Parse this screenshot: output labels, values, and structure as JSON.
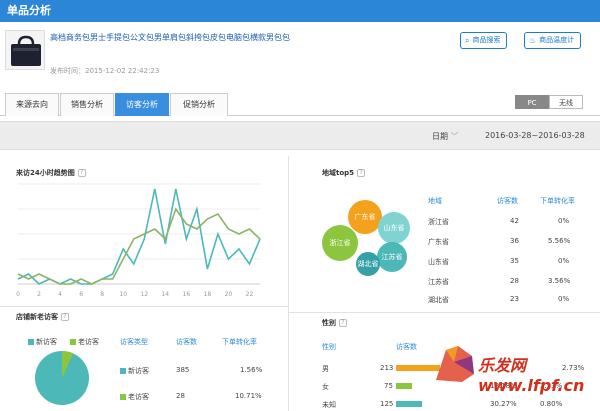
{
  "header": {
    "title": "单品分析"
  },
  "product": {
    "title": "高档商务包男士手提包公文包男单肩包斜挎包皮包电脑包横款男包包",
    "time": "发布时间：2015-12-02 22:42:23",
    "search_btn": "商品搜索",
    "temp_btn": "商品温度计"
  },
  "tabs": [
    "来源去向",
    "销售分析",
    "访客分析",
    "促销分析"
  ],
  "device": {
    "pc": "PC",
    "wireless": "无线"
  },
  "datebar": {
    "label": "日期",
    "range": "2016-03-28~2016-03-28"
  },
  "trend": {
    "title": "来访24小时趋势图",
    "x_ticks": [
      "0",
      "2",
      "4",
      "6",
      "8",
      "10",
      "12",
      "14",
      "16",
      "18",
      "20",
      "22"
    ]
  },
  "region": {
    "title": "地域top5",
    "headers": [
      "地域",
      "访客数",
      "下单转化率"
    ],
    "rows": [
      [
        "浙江省",
        "42",
        "0%"
      ],
      [
        "广东省",
        "36",
        "5.56%"
      ],
      [
        "山东省",
        "35",
        "0%"
      ],
      [
        "江苏省",
        "28",
        "3.56%"
      ],
      [
        "湖北省",
        "23",
        "0%"
      ]
    ],
    "bubbles": [
      "广东省",
      "山东省",
      "浙江省",
      "江苏省",
      "湖北省"
    ]
  },
  "newold": {
    "title": "店铺新老访客",
    "legend": [
      "新访客",
      "老访客"
    ],
    "headers": [
      "访客类型",
      "访客数",
      "下单转化率"
    ],
    "rows": [
      [
        "新访客",
        "385",
        "1.56%"
      ],
      [
        "老访客",
        "28",
        "10.71%"
      ]
    ]
  },
  "gender": {
    "title": "性别",
    "headers": [
      "性别",
      "访客数"
    ],
    "rows": [
      [
        "男",
        "213",
        "",
        "2.73%"
      ],
      [
        "女",
        "75",
        "18.18%",
        "2.33%"
      ],
      [
        "未知",
        "125",
        "30.27%",
        "0.80%"
      ]
    ]
  },
  "watermark": "乐发网 www.lfpf.cn",
  "chart_data": {
    "type": "line",
    "x": [
      0,
      1,
      2,
      3,
      4,
      5,
      6,
      7,
      8,
      9,
      10,
      11,
      12,
      13,
      14,
      15,
      16,
      17,
      18,
      19,
      20,
      21,
      22,
      23
    ],
    "series": [
      {
        "values": [
          5,
          10,
          0,
          5,
          0,
          5,
          0,
          0,
          5,
          10,
          35,
          20,
          45,
          95,
          40,
          95,
          45,
          75,
          15,
          50,
          25,
          35,
          20,
          45
        ]
      },
      {
        "values": [
          10,
          5,
          10,
          5,
          0,
          0,
          5,
          0,
          5,
          5,
          25,
          45,
          50,
          55,
          45,
          75,
          60,
          55,
          65,
          70,
          55,
          50,
          55,
          45
        ]
      }
    ],
    "ylim": [
      0,
      100
    ],
    "colors": [
      "#4cb8b8",
      "#8cb366"
    ],
    "grid": true
  }
}
